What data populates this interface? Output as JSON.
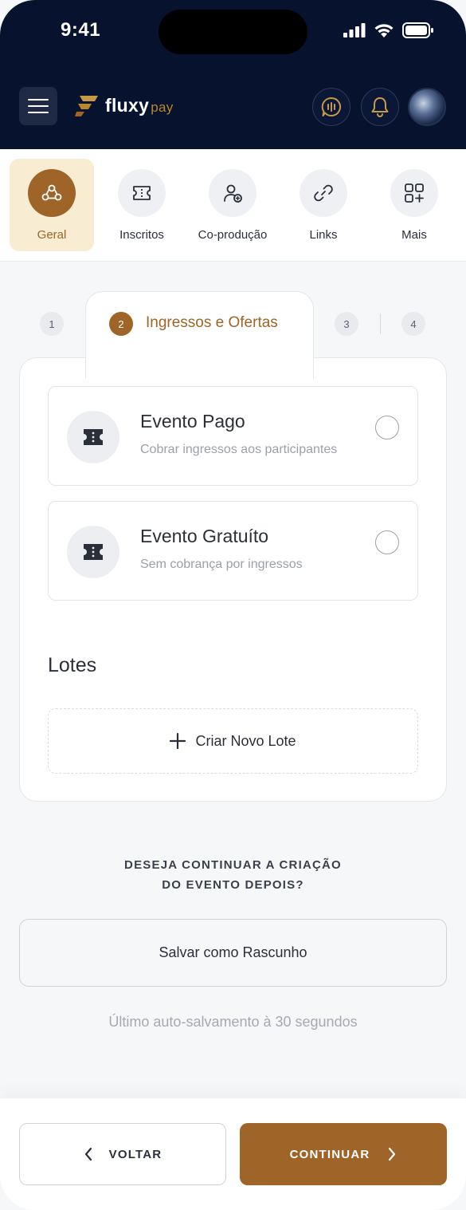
{
  "status": {
    "time": "9:41"
  },
  "header": {
    "logo_main": "fluxy",
    "logo_sub": "pay"
  },
  "nav": {
    "items": [
      {
        "label": "Geral",
        "icon": "group-icon",
        "active": true
      },
      {
        "label": "Inscritos",
        "icon": "ticket-icon",
        "active": false
      },
      {
        "label": "Co-produção",
        "icon": "user-add-icon",
        "active": false
      },
      {
        "label": "Links",
        "icon": "link-icon",
        "active": false
      },
      {
        "label": "Mais",
        "icon": "grid-plus-icon",
        "active": false
      }
    ]
  },
  "stepper": {
    "steps": [
      "1",
      "2",
      "3",
      "4"
    ],
    "active_step": "2",
    "active_title": "Ingressos e Ofertas"
  },
  "options": [
    {
      "title": "Evento Pago",
      "subtitle": "Cobrar ingressos aos participantes"
    },
    {
      "title": "Evento Gratuíto",
      "subtitle": "Sem cobrança por ingressos"
    }
  ],
  "lotes": {
    "title": "Lotes",
    "new_label": "Criar Novo Lote"
  },
  "draft": {
    "question_line1": "DESEJA CONTINUAR A CRIAÇÃO",
    "question_line2": "DO EVENTO DEPOIS?",
    "button_label": "Salvar como Rascunho",
    "autosave_text": "Último auto-salvamento à 30 segundos"
  },
  "footer": {
    "back_label": "VOLTAR",
    "next_label": "CONTINUAR"
  },
  "colors": {
    "header_bg": "#06122e",
    "accent": "#9f6427",
    "accent_light": "#f8ecd3"
  }
}
